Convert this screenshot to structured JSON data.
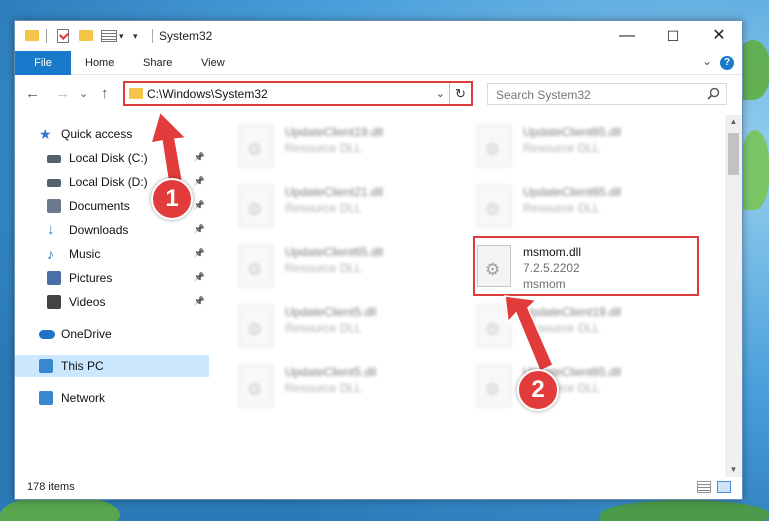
{
  "window": {
    "title": "System32",
    "controls": {
      "minimize": "—",
      "maximize": "☐",
      "close": "✕"
    }
  },
  "ribbon": {
    "tabs": [
      "File",
      "Home",
      "Share",
      "View"
    ],
    "chevron": "⌄",
    "help": "?"
  },
  "address": {
    "path": "C:\\Windows\\System32",
    "dropdown": "⌄",
    "refresh": "↻"
  },
  "search": {
    "placeholder": "Search System32",
    "icon": "search-icon"
  },
  "nav": {
    "back": "←",
    "forward": "→",
    "recent": "⌄",
    "up": "↑"
  },
  "sidebar": {
    "items": [
      {
        "label": "Quick access",
        "icon": "star-icon",
        "color": "#2b79d0"
      },
      {
        "label": "Local Disk (C:)",
        "icon": "drive-icon",
        "color": "#556070",
        "pinned": true
      },
      {
        "label": "Local Disk (D:)",
        "icon": "drive-icon",
        "color": "#556070",
        "pinned": true
      },
      {
        "label": "Documents",
        "icon": "documents-icon",
        "color": "#6a7a8c",
        "pinned": true
      },
      {
        "label": "Downloads",
        "icon": "downloads-icon",
        "color": "#2b79d0",
        "pinned": true
      },
      {
        "label": "Music",
        "icon": "music-icon",
        "color": "#2b79d0",
        "pinned": true
      },
      {
        "label": "Pictures",
        "icon": "pictures-icon",
        "color": "#4a6fa8",
        "pinned": true
      },
      {
        "label": "Videos",
        "icon": "videos-icon",
        "color": "#444",
        "pinned": true
      },
      {
        "label": "OneDrive",
        "icon": "onedrive-icon",
        "color": "#1e73c8"
      },
      {
        "label": "This PC",
        "icon": "computer-icon",
        "color": "#3b87cf"
      },
      {
        "label": "Network",
        "icon": "network-icon",
        "color": "#3b87cf"
      }
    ]
  },
  "files": [
    {
      "name": "UpdateClient19.dll",
      "type": "Resource DLL",
      "blurred": true
    },
    {
      "name": "UpdateClient65.dll",
      "type": "Resource DLL",
      "blurred": true
    },
    {
      "name": "UpdateClient21.dll",
      "type": "Resource DLL",
      "blurred": true
    },
    {
      "name": "UpdateClient65.dll",
      "type": "Resource DLL",
      "blurred": true
    },
    {
      "name": "UpdateClient65.dll",
      "type": "Resource DLL",
      "blurred": true
    },
    {
      "name": "msmom.dll",
      "version": "7.2.5.2202",
      "type": "msmom",
      "blurred": false
    },
    {
      "name": "UpdateClient5.dll",
      "type": "Resource DLL",
      "blurred": true
    },
    {
      "name": "UpdateClient19.dll",
      "type": "Resource DLL",
      "blurred": true
    },
    {
      "name": "UpdateClient5.dll",
      "type": "Resource DLL",
      "blurred": true
    },
    {
      "name": "UpdateClient65.dll",
      "type": "Resource DLL",
      "blurred": true
    }
  ],
  "status": {
    "count": "178 items"
  },
  "callouts": {
    "one": "1",
    "two": "2",
    "color": "#e23b3b"
  }
}
